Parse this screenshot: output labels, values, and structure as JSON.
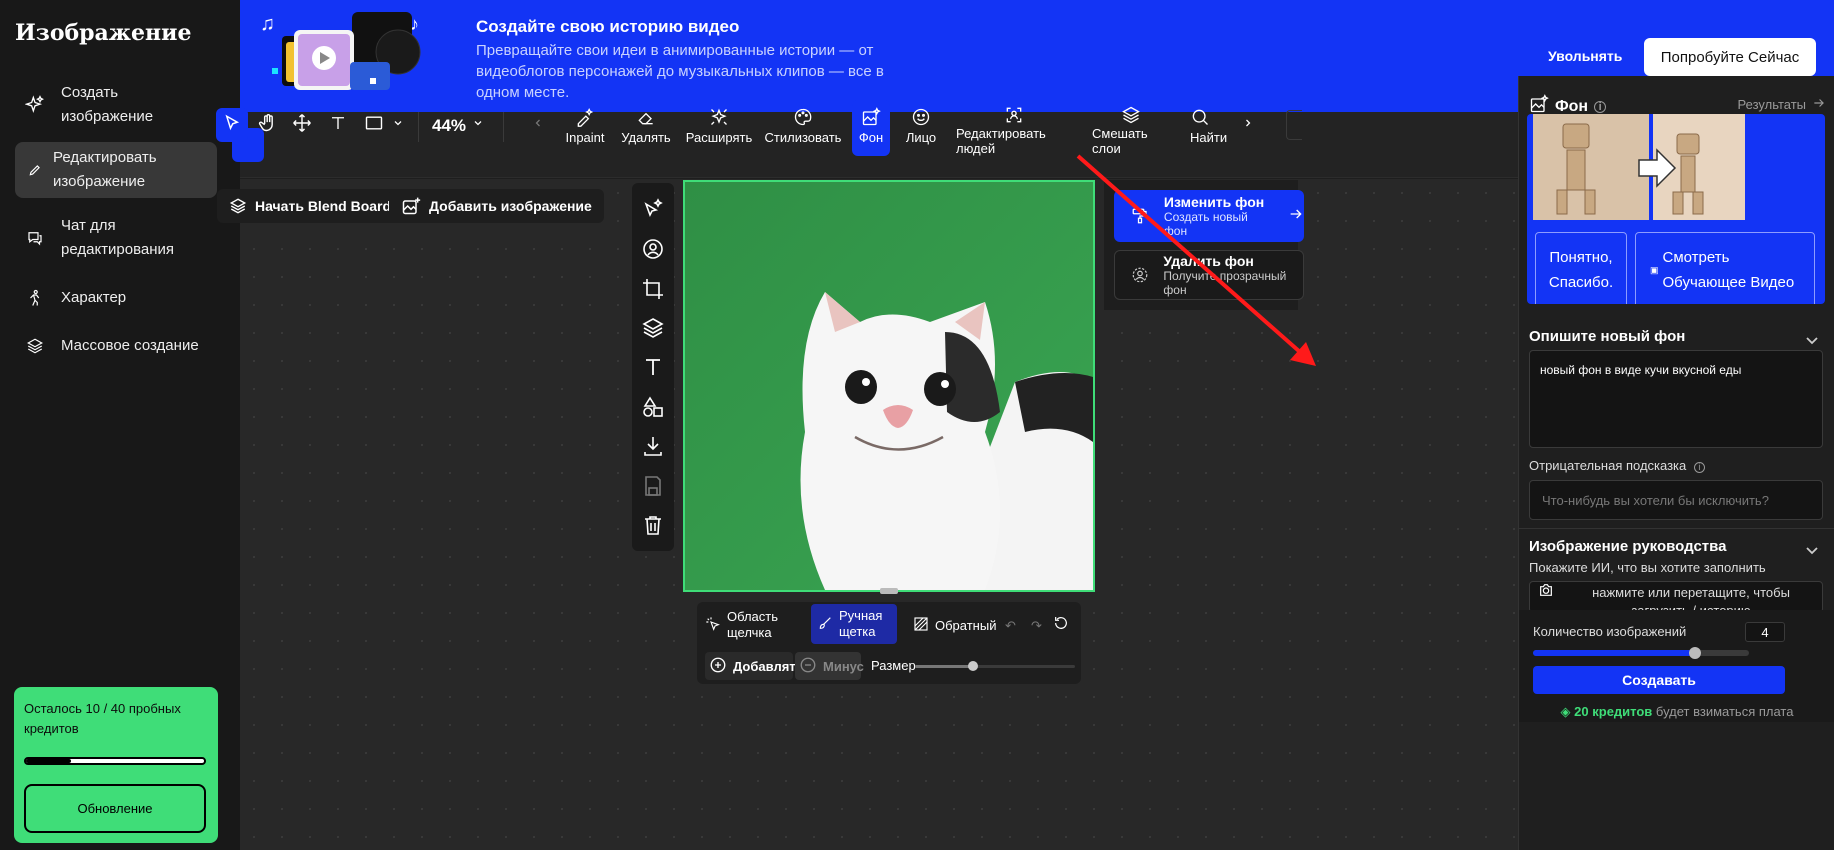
{
  "sidebar": {
    "title": "Изображение",
    "items": [
      {
        "label": "Создать изображение",
        "icon": "sparkle-icon",
        "active": false
      },
      {
        "label": "Редактировать изображение",
        "icon": "pencil-icon",
        "active": true
      },
      {
        "label": "Чат для редактирования",
        "icon": "chat-icon",
        "active": false
      },
      {
        "label": "Характер",
        "icon": "person-run-icon",
        "active": false
      },
      {
        "label": "Массовое создание",
        "icon": "layers-icon",
        "active": false
      }
    ],
    "credits": {
      "text": "Осталось 10 / 40 пробных кредитов",
      "progress": 0.25,
      "upgrade_label": "Обновление",
      "bg_color": "#3fdd78"
    }
  },
  "banner": {
    "title": "Создайте свою историю видео",
    "description": "Превращайте свои идеи в анимированные истории — от видеоблогов персонажей до музыкальных клипов — все в одном месте.",
    "dismiss_label": "Увольнять",
    "try_label": "Попробуйте Сейчас",
    "bg_color": "#1334f5"
  },
  "toolbar": {
    "zoom": "44%",
    "tools": [
      {
        "label": "Inpaint",
        "icon": "brush-sparkle-icon"
      },
      {
        "label": "Удалять",
        "icon": "eraser-icon"
      },
      {
        "label": "Расширять",
        "icon": "expand-sparkle-icon"
      },
      {
        "label": "Стилизовать",
        "icon": "palette-icon"
      },
      {
        "label": "Фон",
        "icon": "background-icon",
        "selected": true
      },
      {
        "label": "Лицо",
        "icon": "smiley-icon"
      },
      {
        "label": "Редактировать людей",
        "icon": "person-scan-icon"
      },
      {
        "label": "Смешать слои",
        "icon": "layers-icon"
      },
      {
        "label": "Найти и",
        "icon": "search-icon"
      }
    ]
  },
  "canvas": {
    "blend_board_label": "Начать Blend Board",
    "add_image_label": "Добавить изображение"
  },
  "bg_menu": {
    "change": {
      "title": "Изменить фон",
      "subtitle": "Создать новый фон"
    },
    "remove": {
      "title": "Удалить фон",
      "subtitle": "Получите прозрачный фон"
    }
  },
  "brush": {
    "click_area": "Область щелчка",
    "manual_brush": "Ручная щетка",
    "inverse": "Обратный",
    "add": "Добавлять",
    "minus": "Минус",
    "size": "Размер",
    "size_value": 0.36
  },
  "panel": {
    "title": "Фон",
    "results": "Результаты",
    "tutorial": {
      "ok_label": "Понятно, Спасибо.",
      "watch_label": "Смотреть Обучающее Видео"
    },
    "describe_title": "Опишите новый фон",
    "prompt_value": "новый фон в виде кучи вкусной еды",
    "negative_label": "Отрицательная подсказка",
    "negative_placeholder": "Что-нибудь вы хотели бы исключить?",
    "guide_title": "Изображение руководства",
    "guide_hint": "Покажите ИИ, что вы хотите заполнить",
    "upload_text": "нажмите или перетащите, чтобы загрузить / историю",
    "quantity_label": "Количество изображений",
    "quantity_value": "4",
    "quantity_slider": 0.75,
    "generate_label": "Создавать",
    "charge_strong": "20 кредитов",
    "charge_rest": "будет взиматься плата"
  }
}
